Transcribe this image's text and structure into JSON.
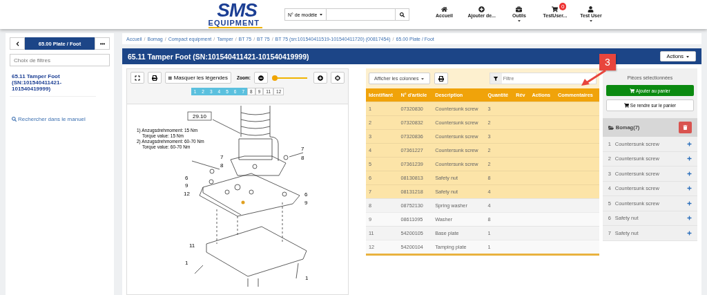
{
  "header": {
    "logo": {
      "line1": "SMS",
      "line2": "EQUIPMENT"
    },
    "search": {
      "dropdown": "N° de modèle"
    },
    "nav": [
      {
        "kind": "home",
        "label": "Accueil",
        "caret": false
      },
      {
        "kind": "add",
        "label": "Ajouter de...",
        "caret": false
      },
      {
        "kind": "tools",
        "label": "Outils",
        "caret": true
      },
      {
        "kind": "cart",
        "label": "TestUser...",
        "caret": false,
        "badge": "0"
      },
      {
        "kind": "user",
        "label": "Test User",
        "caret": true
      }
    ]
  },
  "sidebar": {
    "section_button": "65.00 Plate / Foot",
    "filter_placeholder": "Choix de filtres",
    "current_item": "65.11 Tamper Foot (SN:101540411421-101540419999)",
    "search_link": "Rechercher dans le manuel"
  },
  "breadcrumb_separator": "/",
  "breadcrumb": [
    "Accueil",
    "Bomag",
    "Compact equipment",
    "Tamper",
    "BT 75",
    "BT 75",
    "BT 75 (sn:101540411519-101540411720) (00817454)",
    "65.00 Plate / Foot"
  ],
  "title": "65.11 Tamper Foot (SN:101540411421-101540419999)",
  "actions_button": "Actions",
  "viewer": {
    "legend_button": "Masquer les légendes",
    "zoom_label": "Zoom:",
    "zoom": {
      "level": 0.02
    },
    "hotspots": [
      {
        "label": "1",
        "selected": true
      },
      {
        "label": "2",
        "selected": true
      },
      {
        "label": "3",
        "selected": true
      },
      {
        "label": "4",
        "selected": true
      },
      {
        "label": "5",
        "selected": true
      },
      {
        "label": "6",
        "selected": true
      },
      {
        "label": "7",
        "selected": true
      },
      {
        "label": "8",
        "selected": false
      },
      {
        "label": "9",
        "selected": false
      },
      {
        "label": "11",
        "selected": false
      },
      {
        "label": "12",
        "selected": false
      }
    ],
    "callouts": [
      {
        "label": "29.10",
        "boxed": true
      },
      {
        "label": "7",
        "boxed": false
      },
      {
        "label": "8",
        "boxed": false
      },
      {
        "label": "7",
        "boxed": false
      },
      {
        "label": "8",
        "boxed": false
      },
      {
        "label": "6",
        "boxed": false
      },
      {
        "label": "9",
        "boxed": false
      },
      {
        "label": "12",
        "boxed": false
      },
      {
        "label": "6",
        "boxed": false
      },
      {
        "label": "9",
        "boxed": false
      },
      {
        "label": "11",
        "boxed": false
      },
      {
        "label": "1",
        "boxed": false
      },
      {
        "label": "1",
        "boxed": false
      }
    ],
    "notes": [
      "1) Anzugsdrehmoment: 15 Nm",
      "Torque value: 15 Nm",
      "2) Anzugsdrehmoment: 60-70 Nm",
      "Torque value: 60-70 Nm"
    ]
  },
  "table": {
    "columns_button": "Afficher les colonnes",
    "filter_placeholder": "Filtre",
    "columns": [
      "Identifiant",
      "N° d'article",
      "Description",
      "Quantité",
      "Rév",
      "Actions",
      "Commentaires"
    ],
    "rows": [
      {
        "id": "1",
        "article": "07320830",
        "description": "Countersunk screw",
        "quantity": "3",
        "selected": true
      },
      {
        "id": "2",
        "article": "07320832",
        "description": "Countersunk screw",
        "quantity": "2",
        "selected": true
      },
      {
        "id": "3",
        "article": "07320836",
        "description": "Countersunk screw",
        "quantity": "3",
        "selected": true
      },
      {
        "id": "4",
        "article": "07361227",
        "description": "Countersunk screw",
        "quantity": "2",
        "selected": true
      },
      {
        "id": "5",
        "article": "07361239",
        "description": "Countersunk screw",
        "quantity": "2",
        "selected": true
      },
      {
        "id": "6",
        "article": "08130813",
        "description": "Safety nut",
        "quantity": "8",
        "selected": true
      },
      {
        "id": "7",
        "article": "08131218",
        "description": "Safety nut",
        "quantity": "4",
        "selected": true
      },
      {
        "id": "8",
        "article": "08752130",
        "description": "Spring washer",
        "quantity": "4",
        "selected": false
      },
      {
        "id": "9",
        "article": "08611095",
        "description": "Washer",
        "quantity": "8",
        "selected": false
      },
      {
        "id": "11",
        "article": "54200105",
        "description": "Base plate",
        "quantity": "1",
        "selected": false
      },
      {
        "id": "12",
        "article": "54200104",
        "description": "Tamping plate",
        "quantity": "1",
        "selected": false
      }
    ]
  },
  "selection": {
    "title": "Pièces sélectionnées",
    "add_button": "Ajouter au panier",
    "cart_button": "Se rendre sur le panier",
    "group": "Bomag(7)",
    "items": [
      {
        "number": "1",
        "name": "Countersunk screw"
      },
      {
        "number": "2",
        "name": "Countersunk screw"
      },
      {
        "number": "3",
        "name": "Countersunk screw"
      },
      {
        "number": "4",
        "name": "Countersunk screw"
      },
      {
        "number": "5",
        "name": "Countersunk screw"
      },
      {
        "number": "6",
        "name": "Safety nut"
      },
      {
        "number": "7",
        "name": "Safety nut"
      }
    ]
  },
  "annotation": {
    "label": "3"
  }
}
